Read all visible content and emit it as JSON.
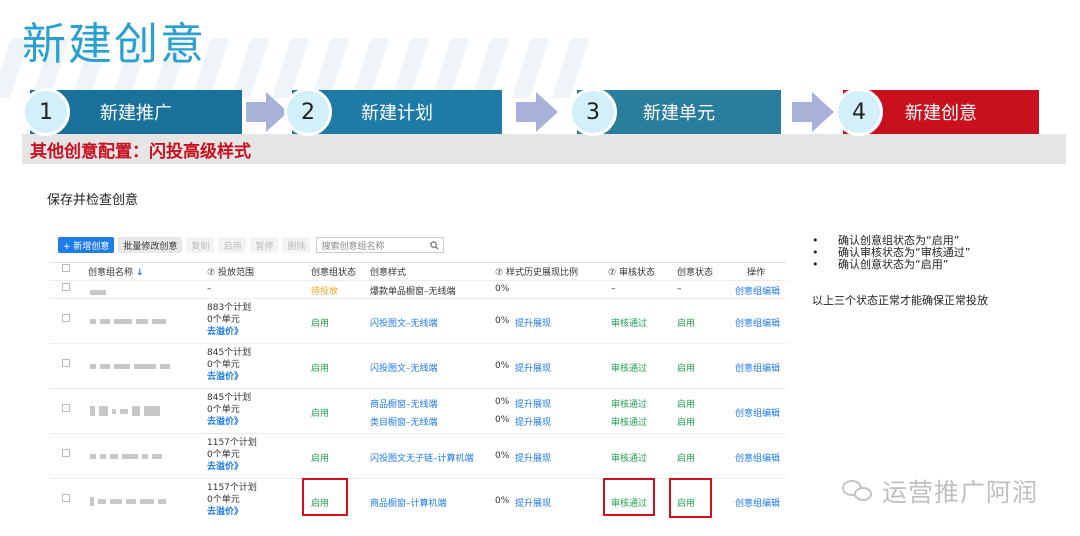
{
  "slide": {
    "title": "新建创意"
  },
  "steps": [
    {
      "num": "1",
      "label": "新建推广",
      "color": "#18729c"
    },
    {
      "num": "2",
      "label": "新建计划",
      "color": "#1e7ba6"
    },
    {
      "num": "3",
      "label": "新建单元",
      "color": "#2a7e9c"
    },
    {
      "num": "4",
      "label": "新建创意",
      "color": "#c9101e"
    }
  ],
  "config_bar": {
    "label": "其他创意配置：闪投高级样式"
  },
  "section": {
    "title": "保存并检查创意"
  },
  "toolbar": {
    "add_label": "+ 新增创意",
    "batch_label": "批量修改创意",
    "copy_label": "复制",
    "enable_label": "启用",
    "pause_label": "暂停",
    "delete_label": "删除",
    "search_placeholder": "搜索创意组名称",
    "search_icon": "search-icon"
  },
  "table": {
    "headers": {
      "name": "创意组名称",
      "sort_icon": "↓",
      "scope": "投放范围",
      "group_status": "创意组状态",
      "style": "创意样式",
      "ratio": "样式历史展现比例",
      "audit": "审核状态",
      "creative_status": "创意状态",
      "ops": "操作"
    },
    "rows": [
      {
        "scope": "–",
        "group_status": "待投放",
        "style": "爆款单品橱窗–无线端",
        "ratio": "0%",
        "audit": "–",
        "creative_status": "–",
        "op": "创意组编辑"
      },
      {
        "plans": "883个计划",
        "units": "0个单元",
        "bid": "去溢价》",
        "group_status": "启用",
        "style": "闪投图文–无线端",
        "ratio": "0%",
        "promote": "提升展现",
        "audit": "审核通过",
        "creative_status": "启用",
        "op": "创意组编辑"
      },
      {
        "plans": "845个计划",
        "units": "0个单元",
        "bid": "去溢价》",
        "group_status": "启用",
        "style": "闪投图文–无线端",
        "ratio": "0%",
        "promote": "提升展现",
        "audit": "审核通过",
        "creative_status": "启用",
        "op": "创意组编辑"
      },
      {
        "plans": "845个计划",
        "units": "0个单元",
        "bid": "去溢价》",
        "group_status": "启用",
        "style": "商品橱窗–无线端",
        "ratio": "0%",
        "promote": "提升展现",
        "audit": "审核通过",
        "creative_status": "启用",
        "style2": "类目橱窗–无线端",
        "ratio2": "0%",
        "promote2": "提升展现",
        "audit2": "审核通过",
        "creative_status2": "启用",
        "op": "创意组编辑"
      },
      {
        "plans": "1157个计划",
        "units": "0个单元",
        "bid": "去溢价》",
        "group_status": "启用",
        "style": "闪投图文无子链–计算机端",
        "ratio": "0%",
        "promote": "提升展现",
        "audit": "审核通过",
        "creative_status": "启用",
        "op": "创意组编辑"
      },
      {
        "plans": "1157个计划",
        "units": "0个单元",
        "bid": "去溢价》",
        "group_status": "启用",
        "style": "商品橱窗–计算机端",
        "ratio": "0%",
        "promote": "提升展现",
        "audit": "审核通过",
        "creative_status": "启用",
        "op": "创意组编辑"
      }
    ]
  },
  "notes": {
    "bullets": [
      "确认创意组状态为“启用”",
      "确认审核状态为“审核通过”",
      "确认创意状态为“启用”"
    ],
    "summary": "以上三个状态正常才能确保正常投放"
  },
  "watermark": {
    "text": "运营推广阿润",
    "icon": "wechat-icon"
  },
  "colors": {
    "accent": "#2aa0cf",
    "link": "#1e7be8",
    "ok": "#22a052",
    "pending": "#f5a623",
    "highlight": "#d0101e"
  }
}
